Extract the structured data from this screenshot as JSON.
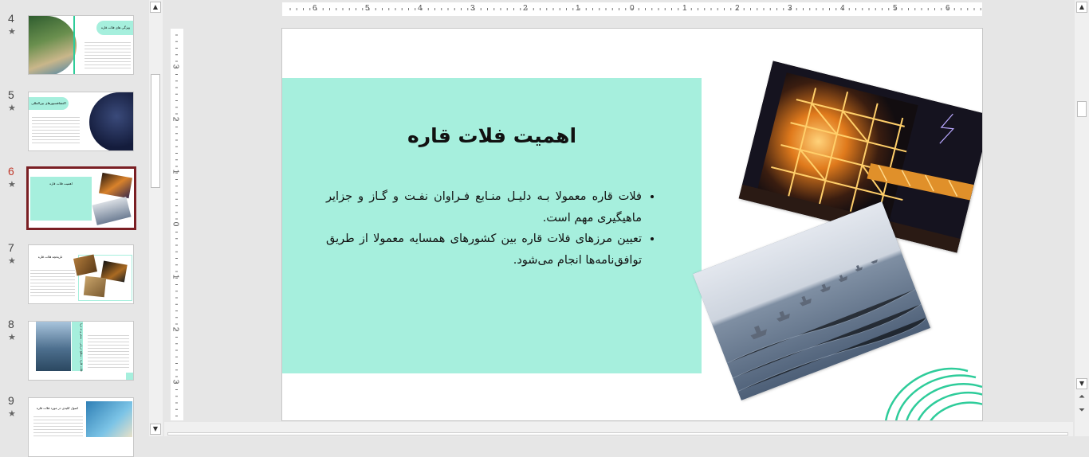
{
  "thumbnails": [
    {
      "number": "4",
      "title": "ویژگی های فلات قاره"
    },
    {
      "number": "5",
      "title": "اکتشافسیورهای بین‌المللی"
    },
    {
      "number": "6",
      "title": "اهمیت فلات قاره"
    },
    {
      "number": "7",
      "title": "تاریخچه فلات قاره"
    },
    {
      "number": "8",
      "title": "فلات قاره - سطح دریایی – بستر و ته دریا"
    },
    {
      "number": "9",
      "title": "اصول کلیدی در مورد فلات قاره"
    }
  ],
  "thumbnail_star": "★",
  "ruler": {
    "horizontal": [
      "6",
      "5",
      "4",
      "3",
      "2",
      "1",
      "0",
      "1",
      "2",
      "3",
      "4",
      "5",
      "6"
    ],
    "vertical": [
      "3",
      "2",
      "1",
      "0",
      "1",
      "2",
      "3"
    ]
  },
  "slide": {
    "title": "اهمیت فلات قاره",
    "bullets": [
      "فلات قاره معمولا بـه دلیـل منـابع فـراوان نفـت و گـاز و جزایر ماهیگیری مهم است.",
      "تعیین مرزهای فلات قاره بین کشورهای همسایه معمولا از طریق توافق‌نامه‌ها انجام می‌شود."
    ]
  },
  "colors": {
    "accent_mint": "#a6efdd",
    "decoration_green": "#2ecc9a",
    "selected_border": "#7a1f24",
    "active_number": "#c0392b"
  }
}
